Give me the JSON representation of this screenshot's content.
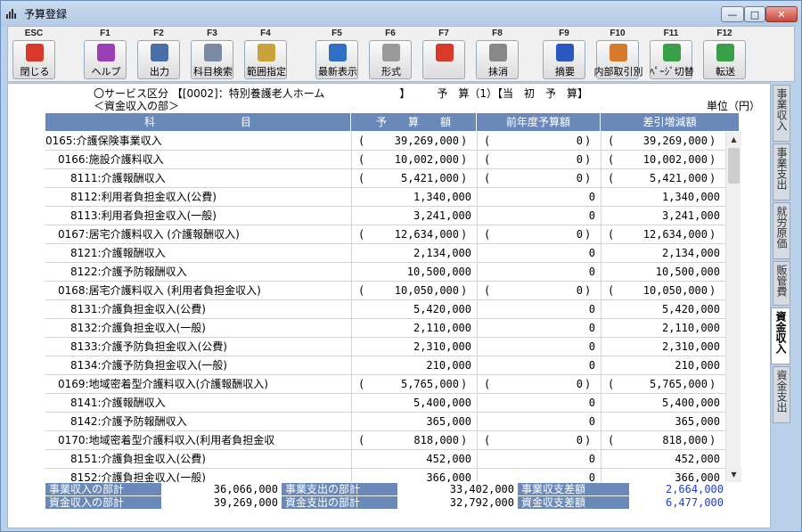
{
  "window": {
    "title": "予算登録",
    "buttons": [
      "—",
      "□",
      "✕"
    ]
  },
  "toolbar": [
    {
      "fkey": "ESC",
      "label": "閉じる",
      "icon": "close-door-icon",
      "color": "#d8392b"
    },
    {
      "fkey": "F1",
      "label": "ヘルプ",
      "icon": "help-icon",
      "color": "#9b3fb6"
    },
    {
      "fkey": "F2",
      "label": "出力",
      "icon": "print-icon",
      "color": "#4a6ea8"
    },
    {
      "fkey": "F3",
      "label": "科目検索",
      "icon": "search-document-icon",
      "color": "#7a8aa0"
    },
    {
      "fkey": "F4",
      "label": "範囲指定",
      "icon": "calendar-icon",
      "color": "#c9a23a"
    },
    {
      "fkey": "F5",
      "label": "最新表示",
      "icon": "refresh-icon",
      "color": "#2f6fc4"
    },
    {
      "fkey": "F6",
      "label": "形式",
      "icon": "gear-icon",
      "color": "#9a9a9a"
    },
    {
      "fkey": "F7",
      "label": "",
      "icon": "prohibit-icon",
      "color": "#d8392b"
    },
    {
      "fkey": "F8",
      "label": "抹消",
      "icon": "erase-icon",
      "color": "#888888"
    },
    {
      "fkey": "F9",
      "label": "摘要",
      "icon": "book-icon",
      "color": "#2a58c0"
    },
    {
      "fkey": "F10",
      "label": "内部取引別",
      "icon": "ledger-icon",
      "color": "#d67a2b"
    },
    {
      "fkey": "F11",
      "label": "ﾍﾟｰｼﾞ切替",
      "icon": "page-switch-icon",
      "color": "#3aa048"
    },
    {
      "fkey": "F12",
      "label": "転送",
      "icon": "transfer-arrow-icon",
      "color": "#3aa048"
    }
  ],
  "header": {
    "line1": "〇サービス区分 【[0002]：特別養護老人ホーム　　　　　　　】　　　予　算（1）【当　初　予　算】",
    "line2": "＜資金収入の部＞",
    "unit": "単位（円）"
  },
  "table": {
    "columns": [
      "科　　　　　　　　目",
      "予　　算　　額",
      "前年度予算額",
      "差引増減額"
    ],
    "rows": [
      {
        "name": "0165:介護保険事業収入",
        "indent": 0,
        "budget": "39,269,000",
        "prev": "0",
        "diff": "39,269,000",
        "paren": true
      },
      {
        "name": "0166:施設介護料収入",
        "indent": 1,
        "budget": "10,002,000",
        "prev": "0",
        "diff": "10,002,000",
        "paren": true
      },
      {
        "name": "8111:介護報酬収入",
        "indent": 2,
        "budget": "5,421,000",
        "prev": "0",
        "diff": "5,421,000",
        "paren": true
      },
      {
        "name": "8112:利用者負担金収入(公費)",
        "indent": 2,
        "budget": "1,340,000",
        "prev": "0",
        "diff": "1,340,000",
        "paren": false
      },
      {
        "name": "8113:利用者負担金収入(一般)",
        "indent": 2,
        "budget": "3,241,000",
        "prev": "0",
        "diff": "3,241,000",
        "paren": false
      },
      {
        "name": "0167:居宅介護料収入 (介護報酬収入)",
        "indent": 1,
        "budget": "12,634,000",
        "prev": "0",
        "diff": "12,634,000",
        "paren": true
      },
      {
        "name": "8121:介護報酬収入",
        "indent": 2,
        "budget": "2,134,000",
        "prev": "0",
        "diff": "2,134,000",
        "paren": false
      },
      {
        "name": "8122:介護予防報酬収入",
        "indent": 2,
        "budget": "10,500,000",
        "prev": "0",
        "diff": "10,500,000",
        "paren": false
      },
      {
        "name": "0168:居宅介護料収入 (利用者負担金収入)",
        "indent": 1,
        "budget": "10,050,000",
        "prev": "0",
        "diff": "10,050,000",
        "paren": true
      },
      {
        "name": "8131:介護負担金収入(公費)",
        "indent": 2,
        "budget": "5,420,000",
        "prev": "0",
        "diff": "5,420,000",
        "paren": false
      },
      {
        "name": "8132:介護負担金収入(一般)",
        "indent": 2,
        "budget": "2,110,000",
        "prev": "0",
        "diff": "2,110,000",
        "paren": false
      },
      {
        "name": "8133:介護予防負担金収入(公費)",
        "indent": 2,
        "budget": "2,310,000",
        "prev": "0",
        "diff": "2,310,000",
        "paren": false
      },
      {
        "name": "8134:介護予防負担金収入(一般)",
        "indent": 2,
        "budget": "210,000",
        "prev": "0",
        "diff": "210,000",
        "paren": false
      },
      {
        "name": "0169:地域密着型介護料収入(介護報酬収入)",
        "indent": 1,
        "budget": "5,765,000",
        "prev": "0",
        "diff": "5,765,000",
        "paren": true
      },
      {
        "name": "8141:介護報酬収入",
        "indent": 2,
        "budget": "5,400,000",
        "prev": "0",
        "diff": "5,400,000",
        "paren": false
      },
      {
        "name": "8142:介護予防報酬収入",
        "indent": 2,
        "budget": "365,000",
        "prev": "0",
        "diff": "365,000",
        "paren": false
      },
      {
        "name": "0170:地域密着型介護料収入(利用者負担金収",
        "indent": 1,
        "budget": "818,000",
        "prev": "0",
        "diff": "818,000",
        "paren": true
      },
      {
        "name": "8151:介護負担金収入(公費)",
        "indent": 2,
        "budget": "452,000",
        "prev": "0",
        "diff": "452,000",
        "paren": false
      },
      {
        "name": "8152:介護負担金収入(一般)",
        "indent": 2,
        "budget": "366,000",
        "prev": "0",
        "diff": "366,000",
        "paren": false
      }
    ]
  },
  "totals": {
    "row1": {
      "l1": "事業収入の部計",
      "v1": "36,066,000",
      "l2": "事業支出の部計",
      "v2": "33,402,000",
      "l3": "事業収支差額",
      "v3": "2,664,000"
    },
    "row2": {
      "l1": "資金収入の部計",
      "v1": "39,269,000",
      "l2": "資金支出の部計",
      "v2": "32,792,000",
      "l3": "資金収支差額",
      "v3": "6,477,000"
    }
  },
  "side_tabs": [
    {
      "label": "事業収入",
      "active": false
    },
    {
      "label": "事業支出",
      "active": false
    },
    {
      "label": "就労原価",
      "active": false
    },
    {
      "label": "販管費",
      "active": false
    },
    {
      "label": "資金収入",
      "active": true
    },
    {
      "label": "資金支出",
      "active": false
    }
  ]
}
